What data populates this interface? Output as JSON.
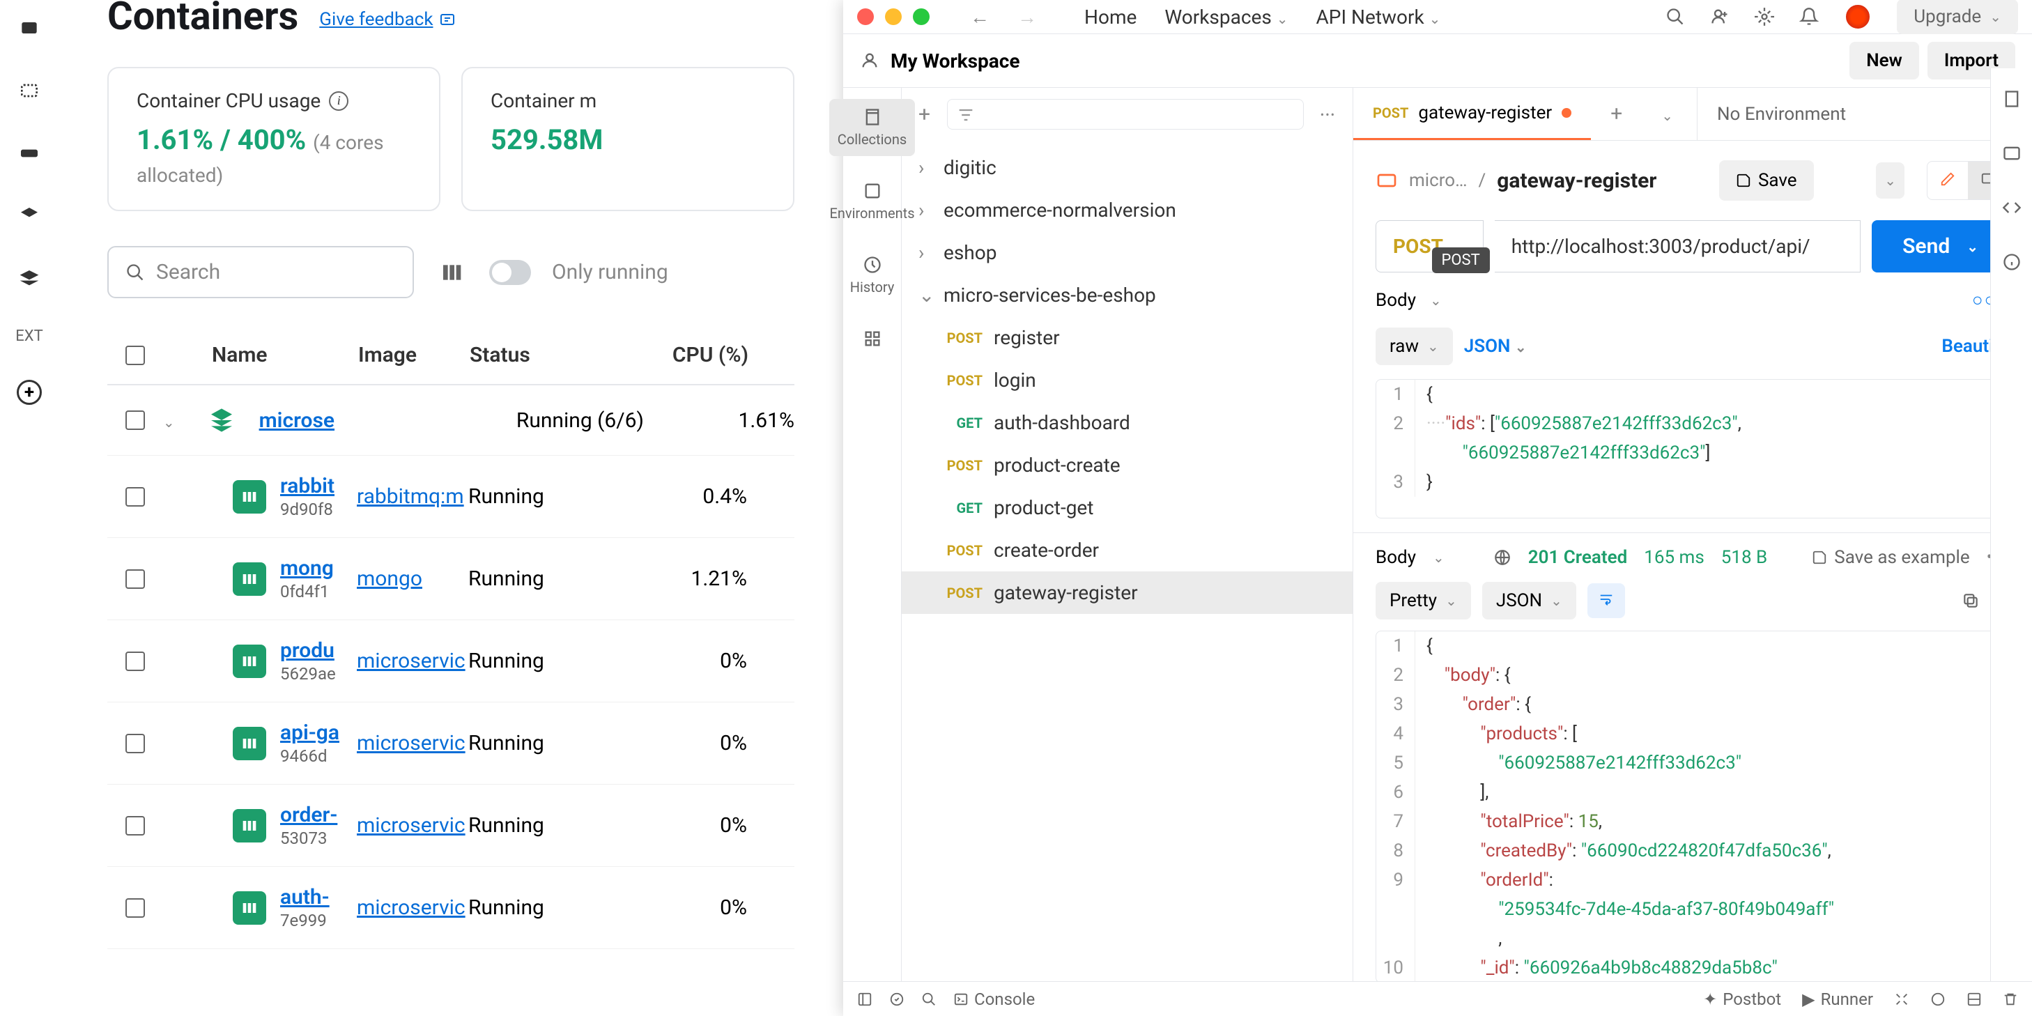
{
  "docker": {
    "title": "Containers",
    "feedback": "Give feedback",
    "stats": {
      "cpu_label": "Container CPU usage",
      "cpu_value": "1.61% / 400%",
      "cpu_note": "(4 cores allocated)",
      "mem_label": "Container m",
      "mem_value": "529.58M"
    },
    "search_placeholder": "Search",
    "only_running": "Only running",
    "columns": {
      "name": "Name",
      "image": "Image",
      "status": "Status",
      "cpu": "CPU (%)"
    },
    "rows": [
      {
        "type": "group",
        "name": "microse",
        "status": "Running (6/6)",
        "cpu": "1.61%"
      },
      {
        "type": "container",
        "name": "rabbit",
        "id": "9d90f8",
        "image": "rabbitmq:m",
        "status": "Running",
        "cpu": "0.4%"
      },
      {
        "type": "container",
        "name": "mong",
        "id": "0fd4f1",
        "image": "mongo",
        "status": "Running",
        "cpu": "1.21%"
      },
      {
        "type": "container",
        "name": "produ",
        "id": "5629ae",
        "image": "microservic",
        "status": "Running",
        "cpu": "0%"
      },
      {
        "type": "container",
        "name": "api-ga",
        "id": "9466d",
        "image": "microservic",
        "status": "Running",
        "cpu": "0%"
      },
      {
        "type": "container",
        "name": "order-",
        "id": "53073",
        "image": "microservic",
        "status": "Running",
        "cpu": "0%"
      },
      {
        "type": "container",
        "name": "auth-",
        "id": "7e999",
        "image": "microservic",
        "status": "Running",
        "cpu": "0%"
      }
    ],
    "ext_label": "EXT"
  },
  "postman": {
    "top_menu": {
      "home": "Home",
      "workspaces": "Workspaces",
      "api_network": "API Network"
    },
    "upgrade": "Upgrade",
    "workspace": "My Workspace",
    "header_btns": {
      "new": "New",
      "import": "Import"
    },
    "rail": {
      "collections": "Collections",
      "environments": "Environments",
      "history": "History"
    },
    "collections": [
      {
        "name": "digitic",
        "expanded": false
      },
      {
        "name": "ecommerce-normalversion",
        "expanded": false
      },
      {
        "name": "eshop",
        "expanded": false
      },
      {
        "name": "micro-services-be-eshop",
        "expanded": true,
        "children": [
          {
            "method": "POST",
            "name": "register"
          },
          {
            "method": "POST",
            "name": "login"
          },
          {
            "method": "GET",
            "name": "auth-dashboard"
          },
          {
            "method": "POST",
            "name": "product-create"
          },
          {
            "method": "GET",
            "name": "product-get"
          },
          {
            "method": "POST",
            "name": "create-order"
          },
          {
            "method": "POST",
            "name": "gateway-register",
            "selected": true
          }
        ]
      }
    ],
    "tab": {
      "method": "POST",
      "name": "gateway-register"
    },
    "env": "No Environment",
    "breadcrumb": {
      "parent": "micro…",
      "sep": "/",
      "current": "gateway-register"
    },
    "save": "Save",
    "request": {
      "method": "POST",
      "method_tooltip": "POST",
      "url": "http://localhost:3003/product/api/",
      "send": "Send",
      "body_tab": "Body",
      "raw": "raw",
      "json": "JSON",
      "beautify": "Beautify",
      "body_lines": [
        {
          "n": "1",
          "tokens": [
            [
              "punct",
              "{"
            ]
          ]
        },
        {
          "n": "2",
          "tokens": [
            [
              "pad",
              "····"
            ],
            [
              "key",
              "\"ids\""
            ],
            [
              "punct",
              ": ["
            ],
            [
              "string",
              "\"660925887e2142fff33d62c3\""
            ],
            [
              "punct",
              ","
            ]
          ]
        },
        {
          "n": "",
          "tokens": [
            [
              "pad",
              "        "
            ],
            [
              "string",
              "\"660925887e2142fff33d62c3\""
            ],
            [
              "punct",
              "]"
            ]
          ]
        },
        {
          "n": "3",
          "tokens": [
            [
              "punct",
              "}"
            ]
          ]
        }
      ]
    },
    "response": {
      "body_tab": "Body",
      "status": "201 Created",
      "time": "165 ms",
      "size": "518 B",
      "save_example": "Save as example",
      "pretty": "Pretty",
      "json": "JSON",
      "lines": [
        {
          "n": "1",
          "tokens": [
            [
              "punct",
              "{"
            ]
          ]
        },
        {
          "n": "2",
          "tokens": [
            [
              "pad",
              "    "
            ],
            [
              "key",
              "\"body\""
            ],
            [
              "punct",
              ": {"
            ]
          ]
        },
        {
          "n": "3",
          "tokens": [
            [
              "pad",
              "        "
            ],
            [
              "key",
              "\"order\""
            ],
            [
              "punct",
              ": {"
            ]
          ]
        },
        {
          "n": "4",
          "tokens": [
            [
              "pad",
              "            "
            ],
            [
              "key",
              "\"products\""
            ],
            [
              "punct",
              ": ["
            ]
          ]
        },
        {
          "n": "5",
          "tokens": [
            [
              "pad",
              "                "
            ],
            [
              "string",
              "\"660925887e2142fff33d62c3\""
            ]
          ]
        },
        {
          "n": "6",
          "tokens": [
            [
              "pad",
              "            "
            ],
            [
              "punct",
              "],"
            ]
          ]
        },
        {
          "n": "7",
          "tokens": [
            [
              "pad",
              "            "
            ],
            [
              "key",
              "\"totalPrice\""
            ],
            [
              "punct",
              ": "
            ],
            [
              "num",
              "15"
            ],
            [
              "punct",
              ","
            ]
          ]
        },
        {
          "n": "8",
          "tokens": [
            [
              "pad",
              "            "
            ],
            [
              "key",
              "\"createdBy\""
            ],
            [
              "punct",
              ": "
            ],
            [
              "string",
              "\"66090cd224820f47dfa50c36\""
            ],
            [
              "punct",
              ","
            ]
          ]
        },
        {
          "n": "9",
          "tokens": [
            [
              "pad",
              "            "
            ],
            [
              "key",
              "\"orderId\""
            ],
            [
              "punct",
              ":"
            ]
          ]
        },
        {
          "n": "",
          "tokens": [
            [
              "pad",
              "                "
            ],
            [
              "string",
              "\"259534fc-7d4e-45da-af37-80f49b049aff\""
            ]
          ]
        },
        {
          "n": "",
          "tokens": [
            [
              "pad",
              "                "
            ],
            [
              "punct",
              ","
            ]
          ]
        },
        {
          "n": "10",
          "tokens": [
            [
              "pad",
              "            "
            ],
            [
              "key",
              "\"_id\""
            ],
            [
              "punct",
              ": "
            ],
            [
              "string",
              "\"660926a4b9b8c48829da5b8c\""
            ]
          ]
        }
      ]
    },
    "footer": {
      "console": "Console",
      "postbot": "Postbot",
      "runner": "Runner"
    }
  }
}
